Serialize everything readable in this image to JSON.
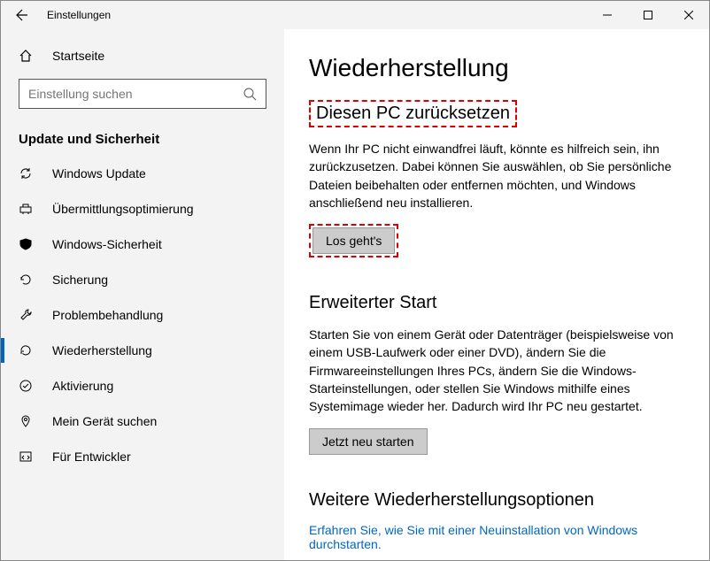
{
  "window": {
    "title": "Einstellungen"
  },
  "sidebar": {
    "home": "Startseite",
    "search_placeholder": "Einstellung suchen",
    "section": "Update und Sicherheit",
    "items": [
      {
        "label": "Windows Update"
      },
      {
        "label": "Übermittlungsoptimierung"
      },
      {
        "label": "Windows-Sicherheit"
      },
      {
        "label": "Sicherung"
      },
      {
        "label": "Problembehandlung"
      },
      {
        "label": "Wiederherstellung"
      },
      {
        "label": "Aktivierung"
      },
      {
        "label": "Mein Gerät suchen"
      },
      {
        "label": "Für Entwickler"
      }
    ]
  },
  "content": {
    "title": "Wiederherstellung",
    "reset": {
      "heading": "Diesen PC zurücksetzen",
      "text": "Wenn Ihr PC nicht einwandfrei läuft, könnte es hilfreich sein, ihn zurückzusetzen. Dabei können Sie auswählen, ob Sie persönliche Dateien beibehalten oder entfernen möchten, und Windows anschließend neu installieren.",
      "button": "Los geht's"
    },
    "advanced": {
      "heading": "Erweiterter Start",
      "text": "Starten Sie von einem Gerät oder Datenträger (beispielsweise von einem USB-Laufwerk oder einer DVD), ändern Sie die Firmwareeinstellungen Ihres PCs, ändern Sie die Windows-Starteinstellungen, oder stellen Sie Windows mithilfe eines Systemimage wieder her. Dadurch wird Ihr PC neu gestartet.",
      "button": "Jetzt neu starten"
    },
    "more": {
      "heading": "Weitere Wiederherstellungsoptionen",
      "link": "Erfahren Sie, wie Sie mit einer Neuinstallation von Windows durchstarten."
    }
  }
}
